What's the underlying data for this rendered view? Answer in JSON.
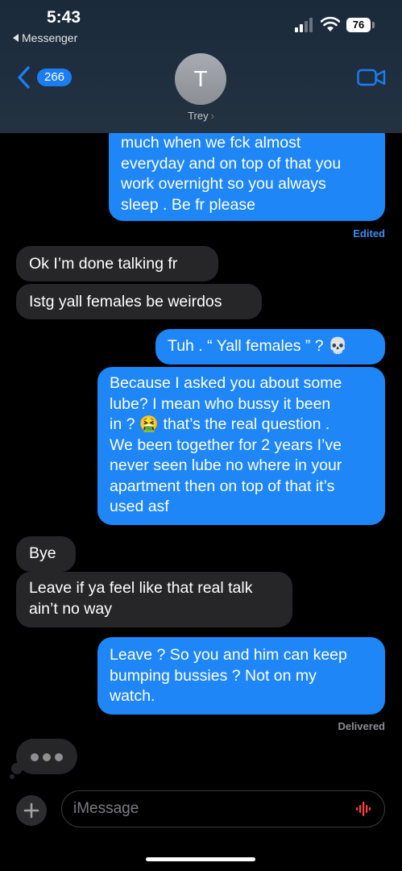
{
  "status_bar": {
    "time": "5:43",
    "back_app": "Messenger",
    "battery": "76"
  },
  "nav": {
    "unread_count": "266",
    "avatar_initial": "T",
    "contact_name": "Trey",
    "accent_color": "#1e86f7"
  },
  "messages": [
    {
      "from": "me",
      "text": "much when we fck almost\neveryday and on top of that you\nwork overnight  so you always\nsleep . Be fr please"
    },
    {
      "from": "them",
      "text": "Ok I’m done talking fr"
    },
    {
      "from": "them",
      "text": "Istg yall females be weirdos"
    },
    {
      "from": "me",
      "text": "Tuh . “ Yall females ” ? 💀"
    },
    {
      "from": "me",
      "text": "Because I asked you about some\nlube? I mean who bussy it been\nin ? 🤮 that’s the real question .\nWe been together for 2 years I’ve\nnever seen lube no where in your\napartment then on top of that it’s\nused asf"
    },
    {
      "from": "them",
      "text": "Bye"
    },
    {
      "from": "them",
      "text": "Leave if ya feel like that real talk\nain’t no way"
    },
    {
      "from": "me",
      "text": "Leave ? So you and him can keep\nbumping bussies ? Not on my\nwatch."
    }
  ],
  "labels": {
    "edited": "Edited",
    "delivered": "Delivered"
  },
  "composer": {
    "placeholder": "iMessage"
  },
  "icons": [
    "back-chevron-icon",
    "video-camera-icon",
    "plus-icon",
    "audio-waveform-icon",
    "cellular-signal-icon",
    "wifi-icon",
    "battery-icon"
  ]
}
